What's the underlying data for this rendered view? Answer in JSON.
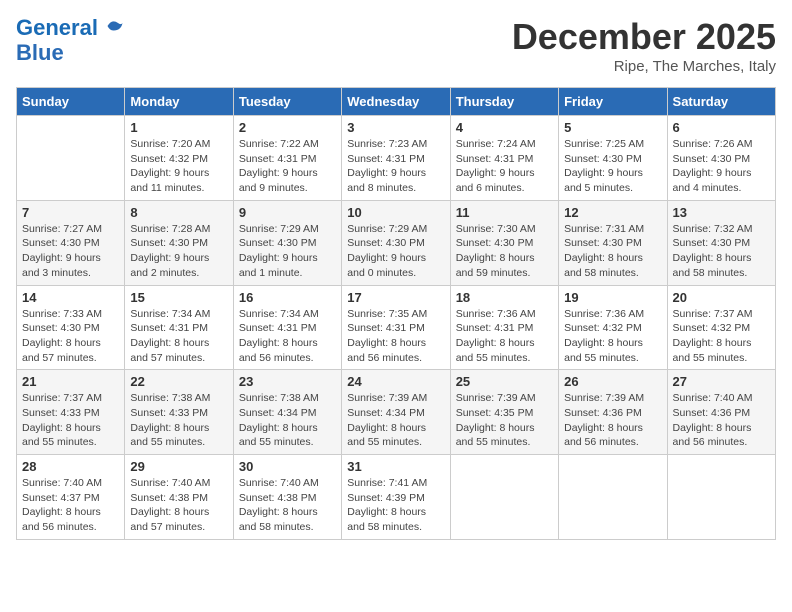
{
  "logo": {
    "line1": "General",
    "line2": "Blue"
  },
  "title": "December 2025",
  "location": "Ripe, The Marches, Italy",
  "headers": [
    "Sunday",
    "Monday",
    "Tuesday",
    "Wednesday",
    "Thursday",
    "Friday",
    "Saturday"
  ],
  "weeks": [
    [
      {
        "day": "",
        "content": ""
      },
      {
        "day": "1",
        "content": "Sunrise: 7:20 AM\nSunset: 4:32 PM\nDaylight: 9 hours\nand 11 minutes."
      },
      {
        "day": "2",
        "content": "Sunrise: 7:22 AM\nSunset: 4:31 PM\nDaylight: 9 hours\nand 9 minutes."
      },
      {
        "day": "3",
        "content": "Sunrise: 7:23 AM\nSunset: 4:31 PM\nDaylight: 9 hours\nand 8 minutes."
      },
      {
        "day": "4",
        "content": "Sunrise: 7:24 AM\nSunset: 4:31 PM\nDaylight: 9 hours\nand 6 minutes."
      },
      {
        "day": "5",
        "content": "Sunrise: 7:25 AM\nSunset: 4:30 PM\nDaylight: 9 hours\nand 5 minutes."
      },
      {
        "day": "6",
        "content": "Sunrise: 7:26 AM\nSunset: 4:30 PM\nDaylight: 9 hours\nand 4 minutes."
      }
    ],
    [
      {
        "day": "7",
        "content": "Sunrise: 7:27 AM\nSunset: 4:30 PM\nDaylight: 9 hours\nand 3 minutes."
      },
      {
        "day": "8",
        "content": "Sunrise: 7:28 AM\nSunset: 4:30 PM\nDaylight: 9 hours\nand 2 minutes."
      },
      {
        "day": "9",
        "content": "Sunrise: 7:29 AM\nSunset: 4:30 PM\nDaylight: 9 hours\nand 1 minute."
      },
      {
        "day": "10",
        "content": "Sunrise: 7:29 AM\nSunset: 4:30 PM\nDaylight: 9 hours\nand 0 minutes."
      },
      {
        "day": "11",
        "content": "Sunrise: 7:30 AM\nSunset: 4:30 PM\nDaylight: 8 hours\nand 59 minutes."
      },
      {
        "day": "12",
        "content": "Sunrise: 7:31 AM\nSunset: 4:30 PM\nDaylight: 8 hours\nand 58 minutes."
      },
      {
        "day": "13",
        "content": "Sunrise: 7:32 AM\nSunset: 4:30 PM\nDaylight: 8 hours\nand 58 minutes."
      }
    ],
    [
      {
        "day": "14",
        "content": "Sunrise: 7:33 AM\nSunset: 4:30 PM\nDaylight: 8 hours\nand 57 minutes."
      },
      {
        "day": "15",
        "content": "Sunrise: 7:34 AM\nSunset: 4:31 PM\nDaylight: 8 hours\nand 57 minutes."
      },
      {
        "day": "16",
        "content": "Sunrise: 7:34 AM\nSunset: 4:31 PM\nDaylight: 8 hours\nand 56 minutes."
      },
      {
        "day": "17",
        "content": "Sunrise: 7:35 AM\nSunset: 4:31 PM\nDaylight: 8 hours\nand 56 minutes."
      },
      {
        "day": "18",
        "content": "Sunrise: 7:36 AM\nSunset: 4:31 PM\nDaylight: 8 hours\nand 55 minutes."
      },
      {
        "day": "19",
        "content": "Sunrise: 7:36 AM\nSunset: 4:32 PM\nDaylight: 8 hours\nand 55 minutes."
      },
      {
        "day": "20",
        "content": "Sunrise: 7:37 AM\nSunset: 4:32 PM\nDaylight: 8 hours\nand 55 minutes."
      }
    ],
    [
      {
        "day": "21",
        "content": "Sunrise: 7:37 AM\nSunset: 4:33 PM\nDaylight: 8 hours\nand 55 minutes."
      },
      {
        "day": "22",
        "content": "Sunrise: 7:38 AM\nSunset: 4:33 PM\nDaylight: 8 hours\nand 55 minutes."
      },
      {
        "day": "23",
        "content": "Sunrise: 7:38 AM\nSunset: 4:34 PM\nDaylight: 8 hours\nand 55 minutes."
      },
      {
        "day": "24",
        "content": "Sunrise: 7:39 AM\nSunset: 4:34 PM\nDaylight: 8 hours\nand 55 minutes."
      },
      {
        "day": "25",
        "content": "Sunrise: 7:39 AM\nSunset: 4:35 PM\nDaylight: 8 hours\nand 55 minutes."
      },
      {
        "day": "26",
        "content": "Sunrise: 7:39 AM\nSunset: 4:36 PM\nDaylight: 8 hours\nand 56 minutes."
      },
      {
        "day": "27",
        "content": "Sunrise: 7:40 AM\nSunset: 4:36 PM\nDaylight: 8 hours\nand 56 minutes."
      }
    ],
    [
      {
        "day": "28",
        "content": "Sunrise: 7:40 AM\nSunset: 4:37 PM\nDaylight: 8 hours\nand 56 minutes."
      },
      {
        "day": "29",
        "content": "Sunrise: 7:40 AM\nSunset: 4:38 PM\nDaylight: 8 hours\nand 57 minutes."
      },
      {
        "day": "30",
        "content": "Sunrise: 7:40 AM\nSunset: 4:38 PM\nDaylight: 8 hours\nand 58 minutes."
      },
      {
        "day": "31",
        "content": "Sunrise: 7:41 AM\nSunset: 4:39 PM\nDaylight: 8 hours\nand 58 minutes."
      },
      {
        "day": "",
        "content": ""
      },
      {
        "day": "",
        "content": ""
      },
      {
        "day": "",
        "content": ""
      }
    ]
  ]
}
